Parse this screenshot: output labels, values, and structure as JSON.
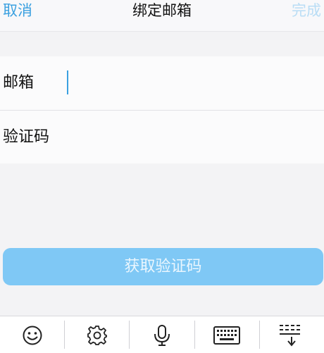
{
  "navbar": {
    "cancel_label": "取消",
    "title": "绑定邮箱",
    "done_label": "完成"
  },
  "form": {
    "email_label": "邮箱",
    "email_value": "",
    "code_label": "验证码",
    "code_value": ""
  },
  "get_code_button": {
    "label": "获取验证码"
  },
  "keyboard_toolbar": {
    "buttons": [
      "emoji-icon",
      "gear-icon",
      "microphone-icon",
      "keyboard-icon",
      "hide-keyboard-icon"
    ]
  },
  "colors": {
    "accent": "#3aa0e0",
    "done_disabled": "#b9ddf5",
    "button_bg": "#7fc8f5",
    "background": "#f3f3f5"
  }
}
